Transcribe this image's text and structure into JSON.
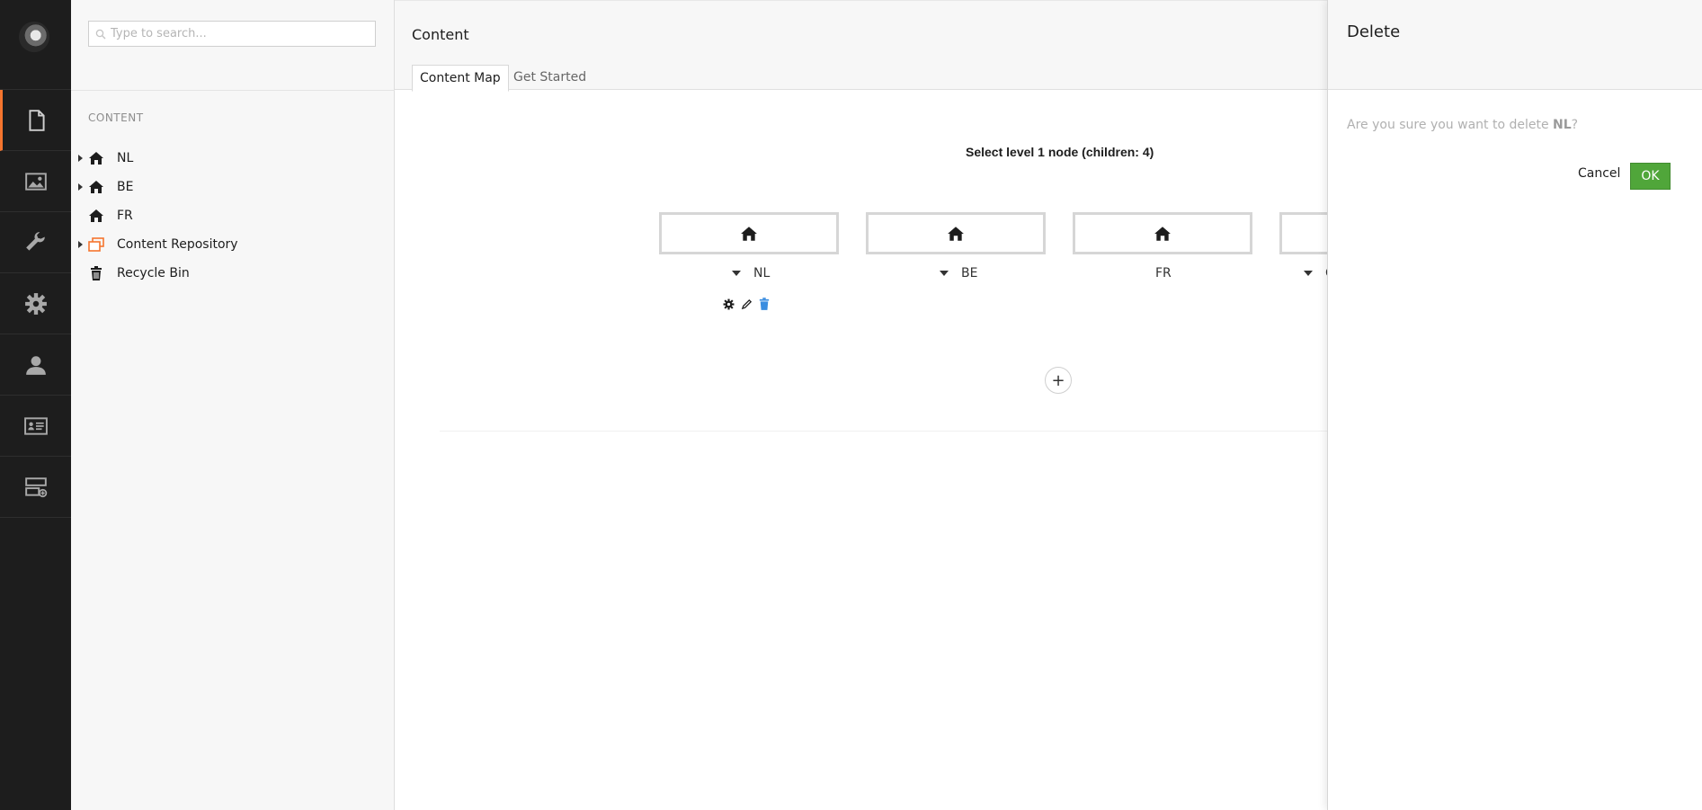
{
  "app": {
    "brand_accent": "#f5752e",
    "sidebar_bg": "#1d1d1d",
    "ok_color": "#50a63a"
  },
  "rail": {
    "avatar_icon": "user-avatar",
    "items": [
      {
        "name": "content",
        "icon": "document-icon"
      },
      {
        "name": "media",
        "icon": "image-icon"
      },
      {
        "name": "settings",
        "icon": "wrench-icon"
      },
      {
        "name": "developer",
        "icon": "gear-icon"
      },
      {
        "name": "users",
        "icon": "person-icon"
      },
      {
        "name": "members",
        "icon": "id-card-icon"
      },
      {
        "name": "forms",
        "icon": "forms-icon"
      }
    ]
  },
  "tree": {
    "search_placeholder": "Type to search...",
    "section_title": "CONTENT",
    "items": [
      {
        "label": "NL",
        "icon": "home-icon",
        "expandable": true
      },
      {
        "label": "BE",
        "icon": "home-icon",
        "expandable": true
      },
      {
        "label": "FR",
        "icon": "home-icon",
        "expandable": false
      },
      {
        "label": "Content Repository",
        "icon": "repository-icon",
        "expandable": true
      },
      {
        "label": "Recycle Bin",
        "icon": "trash-icon",
        "expandable": false
      }
    ]
  },
  "main": {
    "title": "Content",
    "tabs": [
      {
        "label": "Content Map",
        "active": true
      },
      {
        "label": "Get Started",
        "active": false
      }
    ],
    "select_label": "Select level 1 node (children: 4)",
    "nodes": [
      {
        "label": "NL",
        "dropdown": true
      },
      {
        "label": "BE",
        "dropdown": true
      },
      {
        "label": "FR",
        "dropdown": false
      },
      {
        "label": "C",
        "dropdown": true
      }
    ],
    "add_label": "+"
  },
  "dialog": {
    "title": "Delete",
    "question_prefix": "Are you sure you want to delete ",
    "question_target": "NL",
    "question_suffix": "?",
    "cancel_label": "Cancel",
    "ok_label": "OK"
  }
}
